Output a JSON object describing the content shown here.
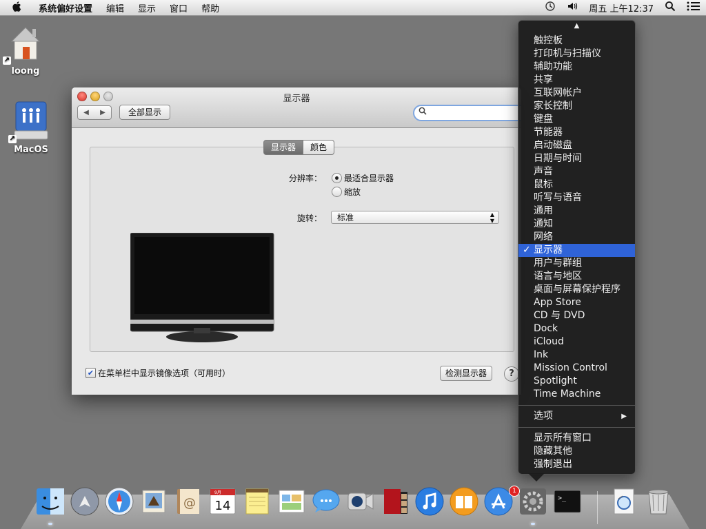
{
  "menubar": {
    "app_name": "系统偏好设置",
    "items": [
      "编辑",
      "显示",
      "窗口",
      "帮助"
    ],
    "clock": "周五 上午12:37"
  },
  "desktop": {
    "icons": [
      {
        "label": "loong",
        "icon": "home-folder-icon"
      },
      {
        "label": "MacOS",
        "icon": "network-volume-icon"
      }
    ]
  },
  "window": {
    "title": "显示器",
    "show_all_label": "全部显示",
    "search_placeholder": "",
    "tabs": [
      "显示器",
      "颜色"
    ],
    "resolution_label": "分辨率：",
    "resolution_options": [
      "最适合显示器",
      "缩放"
    ],
    "resolution_selected": "最适合显示器",
    "rotation_label": "旋转：",
    "rotation_value": "标准",
    "mirror_checkbox_label": "在菜单栏中显示镜像选项（可用时）",
    "mirror_checked": true,
    "detect_button": "检测显示器",
    "help_button": "?"
  },
  "context_menu": {
    "items": [
      "触控板",
      "打印机与扫描仪",
      "辅助功能",
      "共享",
      "互联网帐户",
      "家长控制",
      "键盘",
      "节能器",
      "启动磁盘",
      "日期与时间",
      "声音",
      "鼠标",
      "听写与语音",
      "通用",
      "通知",
      "网络",
      "显示器",
      "用户与群组",
      "语言与地区",
      "桌面与屏幕保护程序",
      "App Store",
      "CD 与 DVD",
      "Dock",
      "iCloud",
      "Ink",
      "Mission Control",
      "Spotlight",
      "Time Machine"
    ],
    "selected": "显示器",
    "options_label": "选项",
    "window_actions": [
      "显示所有窗口",
      "隐藏其他",
      "强制退出"
    ]
  },
  "dock": {
    "items": [
      "finder-icon",
      "launchpad-icon",
      "safari-icon",
      "mail-icon",
      "contacts-icon",
      "calendar-icon",
      "notes-icon",
      "reminders-icon",
      "messages-icon",
      "facetime-icon",
      "photo-booth-icon",
      "itunes-icon",
      "ibooks-icon",
      "app-store-icon",
      "system-preferences-icon",
      "terminal-icon",
      "preview-icon",
      "trash-icon"
    ],
    "calendar_day": "14",
    "calendar_month": "9月",
    "app_store_badge": "1",
    "terminal_prompt": ">_"
  },
  "colors": {
    "menu_selection": "#2f63d8",
    "desktop": "#777777"
  }
}
